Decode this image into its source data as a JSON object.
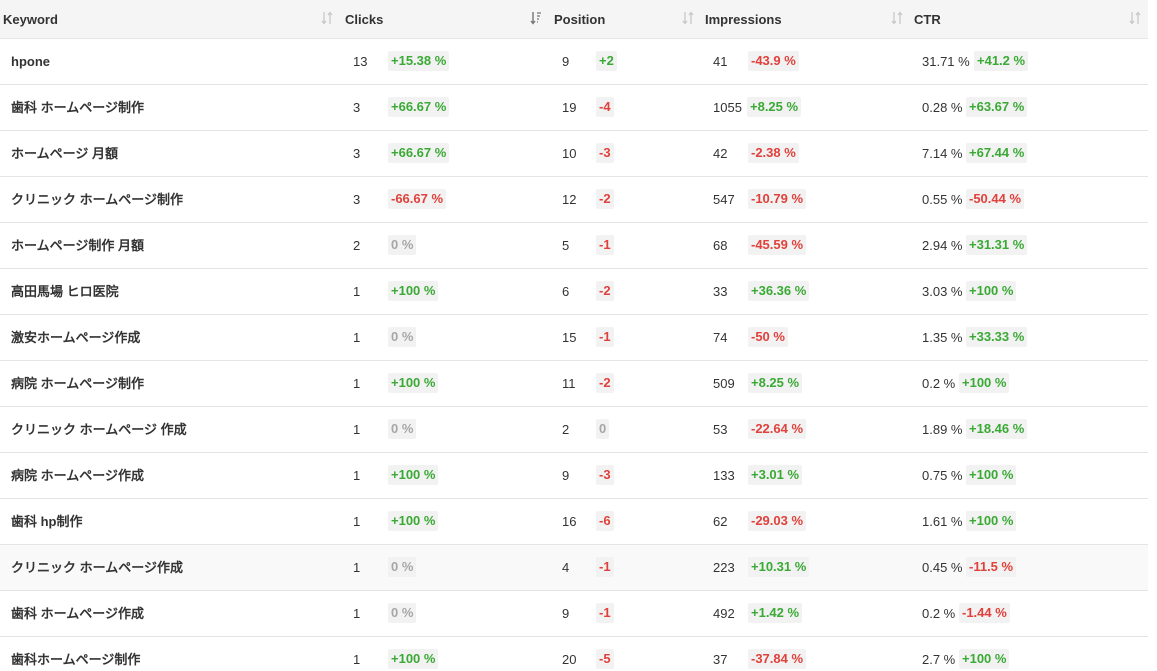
{
  "columns": {
    "keyword": "Keyword",
    "clicks": "Clicks",
    "position": "Position",
    "impressions": "Impressions",
    "ctr": "CTR"
  },
  "sort_icons": {
    "keyword": "sort-neutral-icon",
    "clicks": "sort-descending-icon",
    "position": "sort-neutral-icon",
    "impressions": "sort-neutral-icon",
    "ctr": "sort-neutral-icon"
  },
  "colors": {
    "positive": "#3aaa35",
    "negative": "#e0413b",
    "neutral": "#a6a6a6",
    "header_bg": "#f5f5f5"
  },
  "rows": [
    {
      "keyword": "hpone",
      "clicks": "13",
      "clicks_change": "+15.38 %",
      "position": "9",
      "position_change": "+2",
      "impressions": "41",
      "impressions_change": "-43.9 %",
      "ctr": "31.71 %",
      "ctr_change": "+41.2 %"
    },
    {
      "keyword": "歯科 ホームページ制作",
      "clicks": "3",
      "clicks_change": "+66.67 %",
      "position": "19",
      "position_change": "-4",
      "impressions": "1055",
      "impressions_change": "+8.25 %",
      "ctr": "0.28 %",
      "ctr_change": "+63.67 %"
    },
    {
      "keyword": "ホームページ 月額",
      "clicks": "3",
      "clicks_change": "+66.67 %",
      "position": "10",
      "position_change": "-3",
      "impressions": "42",
      "impressions_change": "-2.38 %",
      "ctr": "7.14 %",
      "ctr_change": "+67.44 %"
    },
    {
      "keyword": "クリニック ホームページ制作",
      "clicks": "3",
      "clicks_change": "-66.67 %",
      "position": "12",
      "position_change": "-2",
      "impressions": "547",
      "impressions_change": "-10.79 %",
      "ctr": "0.55 %",
      "ctr_change": "-50.44 %"
    },
    {
      "keyword": "ホームページ制作 月額",
      "clicks": "2",
      "clicks_change": "0 %",
      "position": "5",
      "position_change": "-1",
      "impressions": "68",
      "impressions_change": "-45.59 %",
      "ctr": "2.94 %",
      "ctr_change": "+31.31 %"
    },
    {
      "keyword": "高田馬場 ヒロ医院",
      "clicks": "1",
      "clicks_change": "+100 %",
      "position": "6",
      "position_change": "-2",
      "impressions": "33",
      "impressions_change": "+36.36 %",
      "ctr": "3.03 %",
      "ctr_change": "+100 %"
    },
    {
      "keyword": "激安ホームページ作成",
      "clicks": "1",
      "clicks_change": "0 %",
      "position": "15",
      "position_change": "-1",
      "impressions": "74",
      "impressions_change": "-50 %",
      "ctr": "1.35 %",
      "ctr_change": "+33.33 %"
    },
    {
      "keyword": "病院 ホームページ制作",
      "clicks": "1",
      "clicks_change": "+100 %",
      "position": "11",
      "position_change": "-2",
      "impressions": "509",
      "impressions_change": "+8.25 %",
      "ctr": "0.2 %",
      "ctr_change": "+100 %"
    },
    {
      "keyword": "クリニック ホームページ 作成",
      "clicks": "1",
      "clicks_change": "0 %",
      "position": "2",
      "position_change": "0",
      "impressions": "53",
      "impressions_change": "-22.64 %",
      "ctr": "1.89 %",
      "ctr_change": "+18.46 %"
    },
    {
      "keyword": "病院 ホームページ作成",
      "clicks": "1",
      "clicks_change": "+100 %",
      "position": "9",
      "position_change": "-3",
      "impressions": "133",
      "impressions_change": "+3.01 %",
      "ctr": "0.75 %",
      "ctr_change": "+100 %"
    },
    {
      "keyword": "歯科 hp制作",
      "clicks": "1",
      "clicks_change": "+100 %",
      "position": "16",
      "position_change": "-6",
      "impressions": "62",
      "impressions_change": "-29.03 %",
      "ctr": "1.61 %",
      "ctr_change": "+100 %"
    },
    {
      "keyword": "クリニック ホームページ作成",
      "clicks": "1",
      "clicks_change": "0 %",
      "position": "4",
      "position_change": "-1",
      "impressions": "223",
      "impressions_change": "+10.31 %",
      "ctr": "0.45 %",
      "ctr_change": "-11.5 %"
    },
    {
      "keyword": "歯科 ホームページ作成",
      "clicks": "1",
      "clicks_change": "0 %",
      "position": "9",
      "position_change": "-1",
      "impressions": "492",
      "impressions_change": "+1.42 %",
      "ctr": "0.2 %",
      "ctr_change": "-1.44 %"
    },
    {
      "keyword": "歯科ホームページ制作",
      "clicks": "1",
      "clicks_change": "+100 %",
      "position": "20",
      "position_change": "-5",
      "impressions": "37",
      "impressions_change": "-37.84 %",
      "ctr": "2.7 %",
      "ctr_change": "+100 %"
    }
  ]
}
